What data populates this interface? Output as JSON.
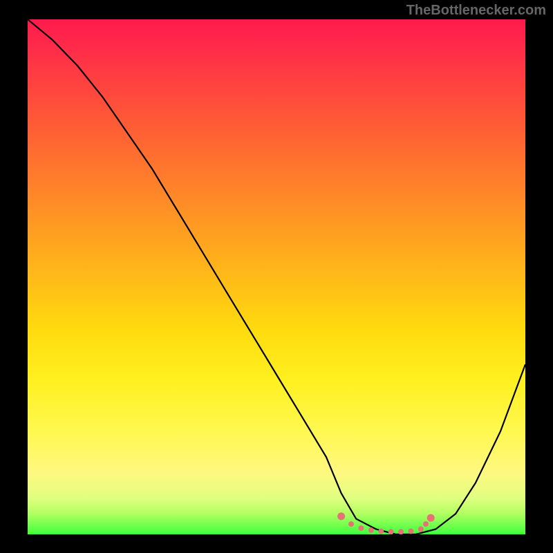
{
  "attribution": "TheBottlenecker.com",
  "chart_data": {
    "type": "line",
    "title": "",
    "xlabel": "",
    "ylabel": "",
    "xlim": [
      0,
      100
    ],
    "ylim": [
      0,
      100
    ],
    "series": [
      {
        "name": "bottleneck-curve",
        "x": [
          0,
          5,
          10,
          15,
          20,
          25,
          30,
          35,
          40,
          45,
          50,
          55,
          60,
          63,
          66,
          70,
          74,
          78,
          82,
          86,
          90,
          95,
          100
        ],
        "y": [
          100,
          96,
          91,
          85,
          78,
          71,
          63,
          55,
          47,
          39,
          31,
          23,
          15,
          8,
          3,
          1,
          0,
          0,
          1,
          4,
          10,
          20,
          33
        ]
      },
      {
        "name": "highlight-dots",
        "x": [
          63,
          65,
          67,
          69,
          71,
          73,
          75,
          77,
          79,
          80,
          81
        ],
        "y": [
          3.5,
          2.0,
          1.2,
          0.8,
          0.6,
          0.5,
          0.5,
          0.6,
          1.0,
          2.0,
          3.2
        ]
      }
    ]
  }
}
